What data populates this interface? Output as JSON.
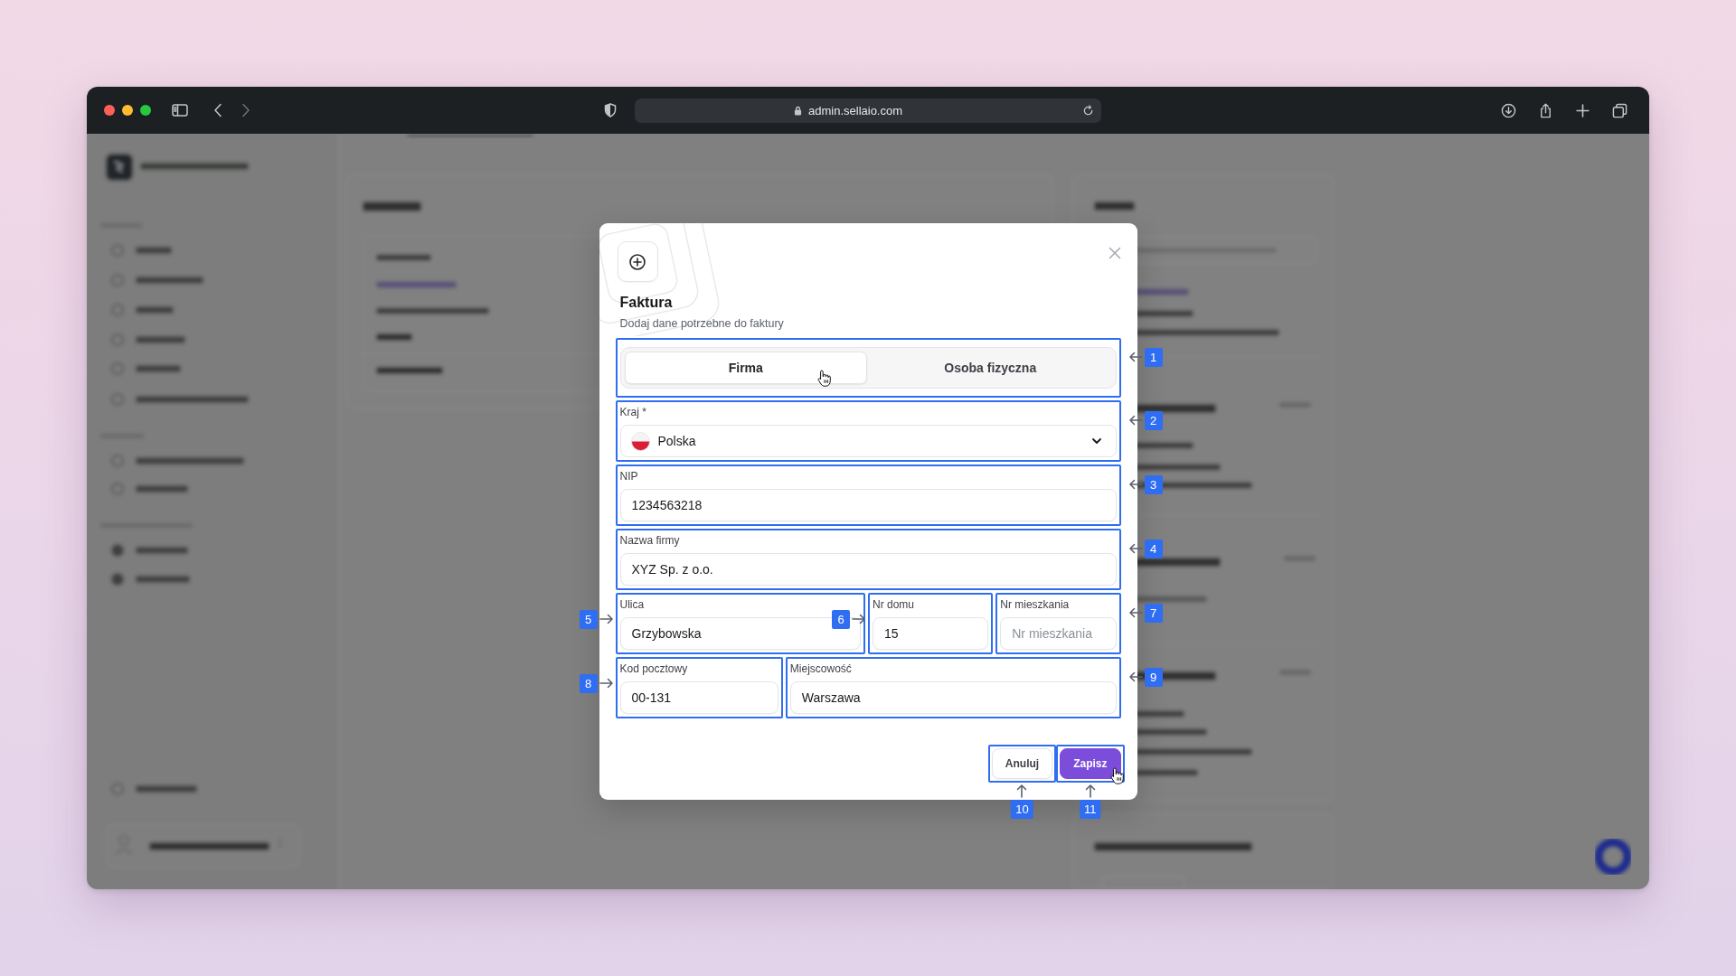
{
  "browser": {
    "url": "admin.sellaio.com"
  },
  "dialog": {
    "title": "Faktura",
    "subtitle": "Dodaj dane potrzebne do faktury",
    "tabs": [
      {
        "label": "Firma",
        "selected": true,
        "pointer": true
      },
      {
        "label": "Osoba fizyczna",
        "selected": false,
        "pointer": false
      }
    ],
    "tabs_annotation": "1",
    "rows": [
      [
        {
          "kind": "select",
          "label": "Kraj *",
          "value": "Polska",
          "annotation": "2"
        }
      ],
      [
        {
          "kind": "text",
          "label": "NIP",
          "value": "1234563218",
          "annotation": "3"
        }
      ],
      [
        {
          "kind": "text",
          "label": "Nazwa firmy",
          "value": "XYZ Sp. z o.o.",
          "annotation": "4"
        }
      ],
      [
        {
          "kind": "text",
          "label": "Ulica",
          "value": "Grzybowska",
          "annotation": "5"
        },
        {
          "kind": "text",
          "label": "Nr domu",
          "value": "15",
          "annotation": "6"
        },
        {
          "kind": "text",
          "label": "Nr mieszkania",
          "placeholder": "Nr mieszkania",
          "annotation": "7"
        }
      ],
      [
        {
          "kind": "text",
          "label": "Kod pocztowy",
          "value": "00-131",
          "annotation": "8"
        },
        {
          "kind": "text",
          "label": "Miejscowość",
          "value": "Warszawa",
          "annotation": "9"
        }
      ]
    ],
    "buttons": [
      {
        "label": "Anuluj",
        "kind": "secondary",
        "pointer": false,
        "annotation": "10"
      },
      {
        "label": "Zapisz",
        "kind": "primary",
        "pointer": true,
        "annotation": "11"
      }
    ]
  }
}
